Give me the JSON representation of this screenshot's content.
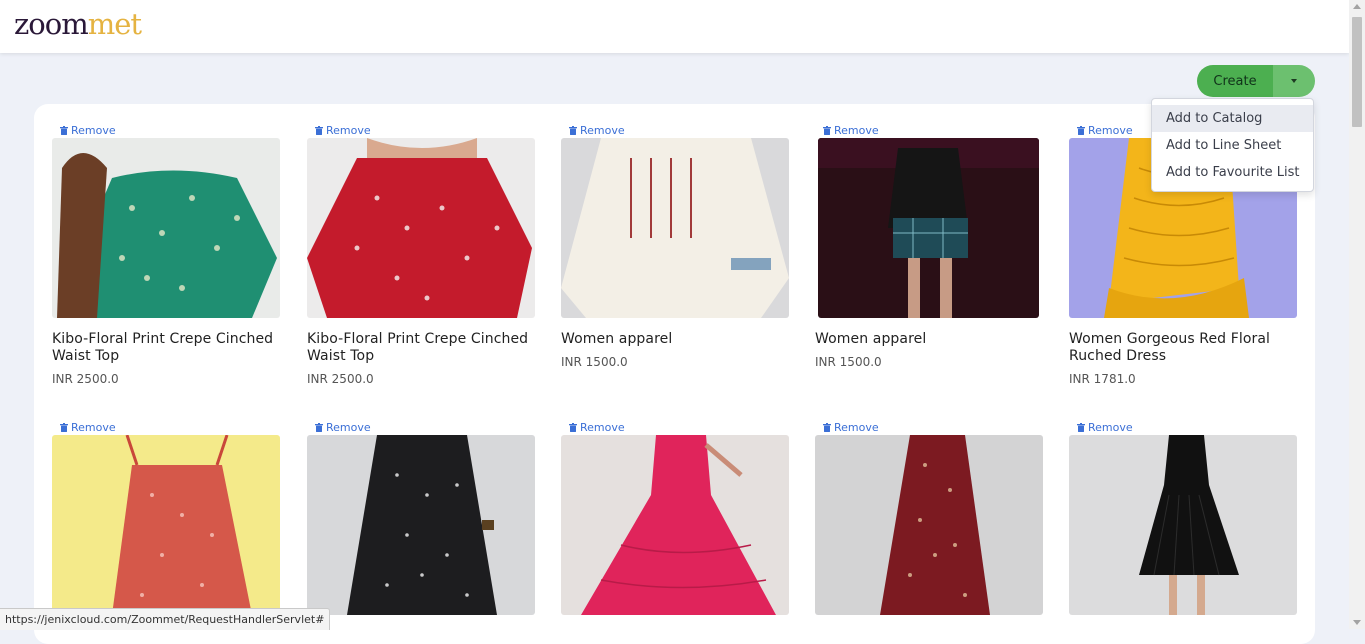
{
  "logo": {
    "part1": "zoom",
    "part2": "met"
  },
  "actions": {
    "create_label": "Create"
  },
  "dropdown": {
    "items": [
      "Add to Catalog",
      "Add to Line Sheet",
      "Add to Favourite List"
    ],
    "active_index": 0
  },
  "remove_label": "Remove",
  "products": [
    {
      "name": "Kibo-Floral Print Crepe Cinched Waist Top",
      "price": "INR 2500.0",
      "image": "green floral top"
    },
    {
      "name": "Kibo-Floral Print Crepe Cinched Waist Top",
      "price": "INR 2500.0",
      "image": "red floral top"
    },
    {
      "name": "Women apparel",
      "price": "INR 1500.0",
      "image": "white embroidered tunic"
    },
    {
      "name": "Women apparel",
      "price": "INR 1500.0",
      "image": "black and plaid outfit"
    },
    {
      "name": "Women Gorgeous Red Floral Ruched Dress",
      "price": "INR 1781.0",
      "image": "yellow ruched dress"
    },
    {
      "name": "",
      "price": "",
      "image": "red floral ruched dress"
    },
    {
      "name": "",
      "price": "",
      "image": "black floral dress"
    },
    {
      "name": "",
      "price": "",
      "image": "pink tiered maxi dress"
    },
    {
      "name": "",
      "price": "",
      "image": "maroon printed maxi dress"
    },
    {
      "name": "",
      "price": "",
      "image": "black pleated dress"
    }
  ],
  "status_url": "https://jenixcloud.com/Zoommet/RequestHandlerServlet#",
  "colors": {
    "accent_green": "#4caf50",
    "link_blue": "#3b6fd6",
    "logo_dark": "#2a1838",
    "logo_gold": "#e5b341"
  }
}
